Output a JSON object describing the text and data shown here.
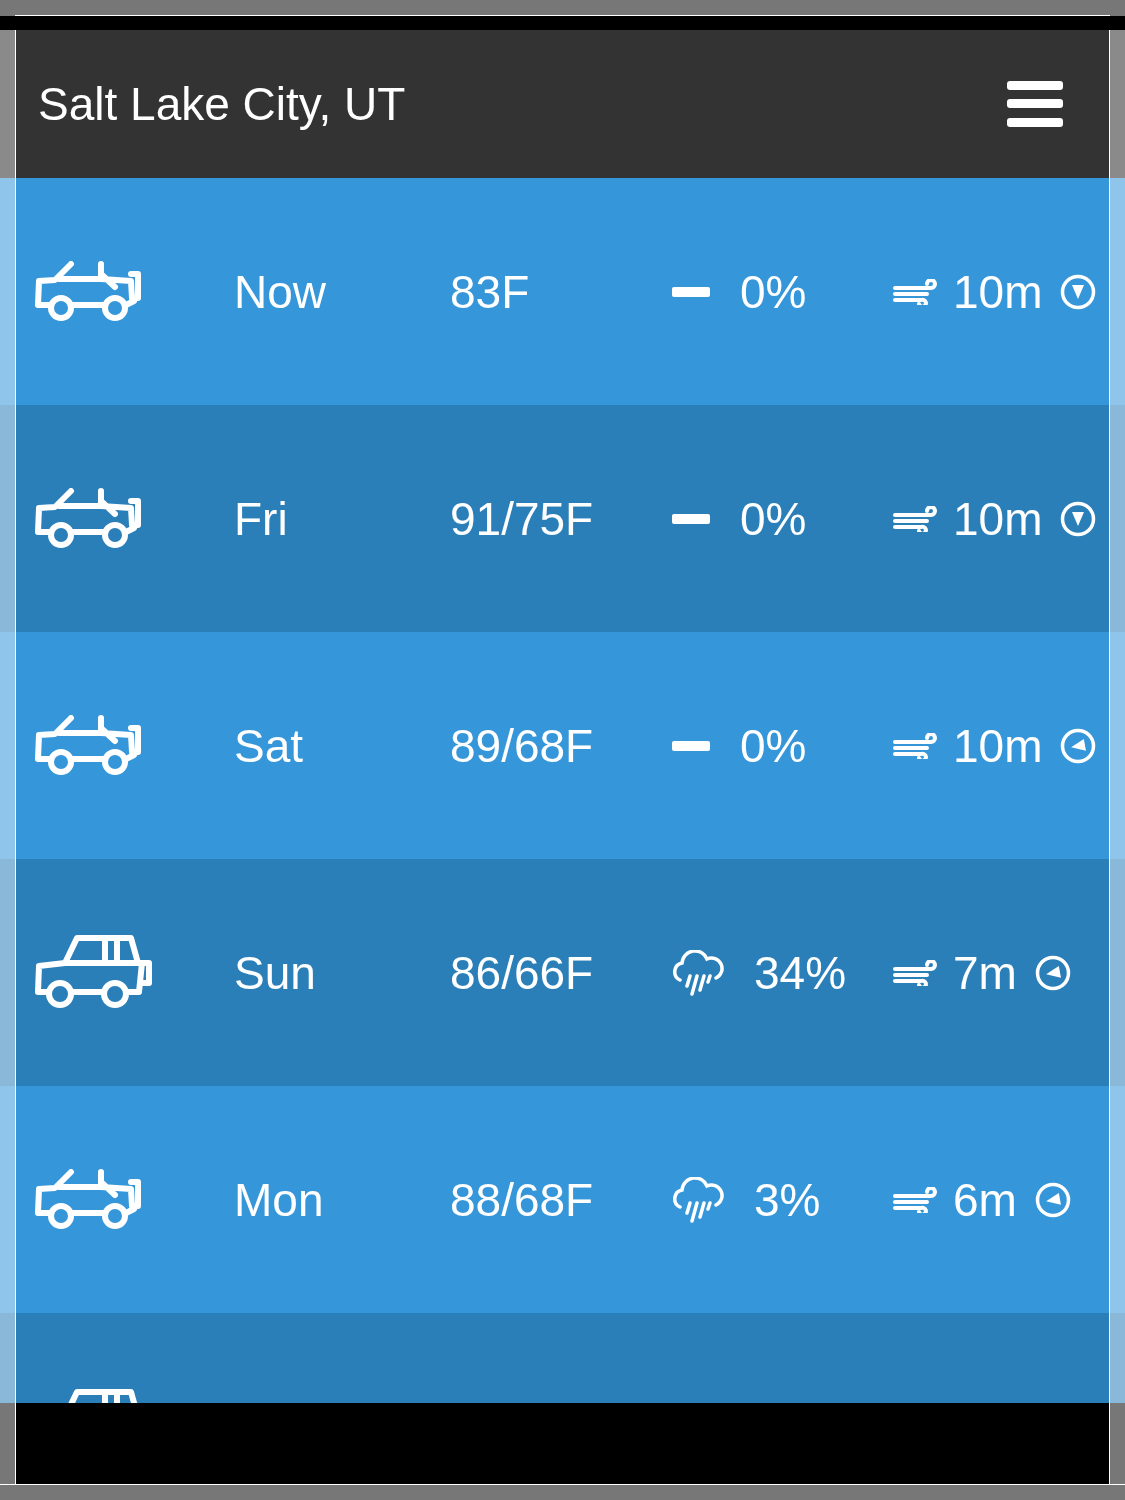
{
  "header": {
    "title": "Salt Lake City, UT"
  },
  "forecast": [
    {
      "vehicle": {
        "kind": "open"
      },
      "day": "Now",
      "temp": "83F",
      "precip": {
        "kind": "none",
        "text": "0%"
      },
      "wind": {
        "text": "10m",
        "direction": {
          "kind": "s"
        }
      }
    },
    {
      "vehicle": {
        "kind": "open"
      },
      "day": "Fri",
      "temp": "91/75F",
      "precip": {
        "kind": "none",
        "text": "0%"
      },
      "wind": {
        "text": "10m",
        "direction": {
          "kind": "s"
        }
      }
    },
    {
      "vehicle": {
        "kind": "open"
      },
      "day": "Sat",
      "temp": "89/68F",
      "precip": {
        "kind": "none",
        "text": "0%"
      },
      "wind": {
        "text": "10m",
        "direction": {
          "kind": "w"
        }
      }
    },
    {
      "vehicle": {
        "kind": "closed"
      },
      "day": "Sun",
      "temp": "86/66F",
      "precip": {
        "kind": "rain",
        "text": "34%"
      },
      "wind": {
        "text": "7m",
        "direction": {
          "kind": "w"
        }
      }
    },
    {
      "vehicle": {
        "kind": "open"
      },
      "day": "Mon",
      "temp": "88/68F",
      "precip": {
        "kind": "rain",
        "text": "3%"
      },
      "wind": {
        "text": "6m",
        "direction": {
          "kind": "w"
        }
      }
    },
    {
      "vehicle": {
        "kind": "closed"
      }
    }
  ]
}
